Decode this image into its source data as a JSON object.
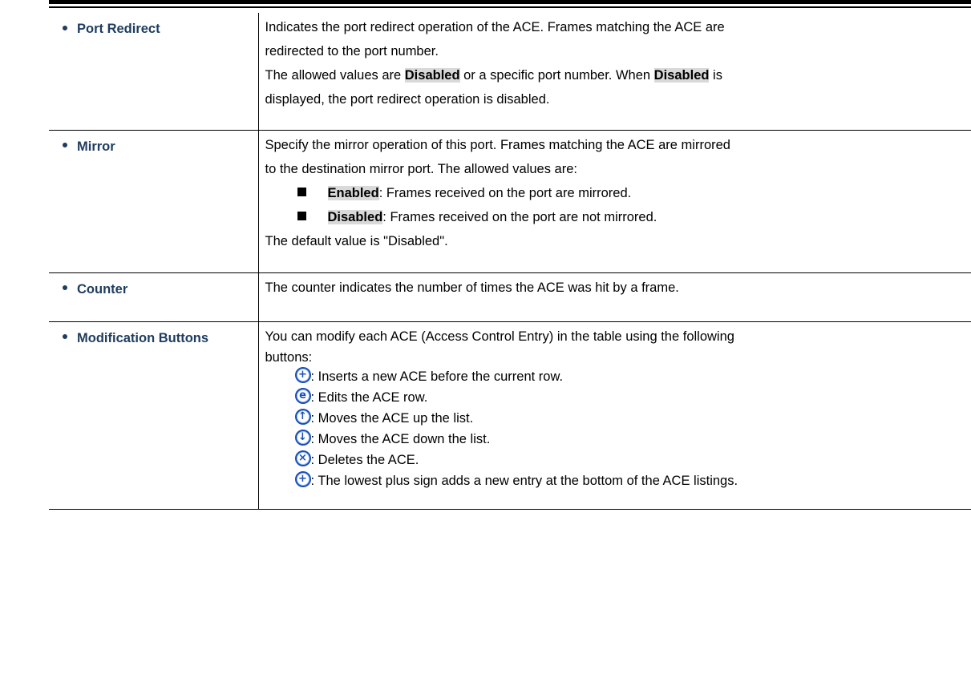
{
  "rows": [
    {
      "name": "Port Redirect",
      "desc1": "Indicates the port redirect operation of the ACE. Frames matching the ACE are",
      "desc2": "redirected to the port number.",
      "desc3a": "The allowed values are ",
      "kw1": "Disabled",
      "desc3b": " or a specific port number. When ",
      "kw2": "Disabled",
      "desc3c": " is",
      "desc4": "displayed, the port redirect operation is disabled."
    },
    {
      "name": "Mirror",
      "desc1": "Specify the mirror operation of this port. Frames matching the ACE are mirrored",
      "desc2": "to the destination mirror port. The allowed values are:",
      "options": [
        {
          "keyword": "Enabled",
          "text": ": Frames received on the port are mirrored."
        },
        {
          "keyword": "Disabled",
          "text": ": Frames received on the port are not mirrored."
        }
      ],
      "default": "The default value is \"Disabled\"."
    },
    {
      "name": "Counter",
      "desc1": "The counter indicates the number of times the ACE was hit by a frame."
    },
    {
      "name": "Modification Buttons",
      "desc1": "You can modify each ACE (Access Control Entry) in the table using the following",
      "desc2": "buttons:",
      "buttons": [
        {
          "icon": "plus-circle-icon",
          "glyph": "+",
          "text": ": Inserts a new ACE before the current row."
        },
        {
          "icon": "edit-circle-icon",
          "glyph": "e",
          "text": ": Edits the ACE row."
        },
        {
          "icon": "up-arrow-circle-icon",
          "glyph": "↑",
          "text": ": Moves the ACE up the list."
        },
        {
          "icon": "down-arrow-circle-icon",
          "glyph": "↓",
          "text": ": Moves the ACE down the list."
        },
        {
          "icon": "delete-circle-icon",
          "glyph": "×",
          "text": ": Deletes the ACE."
        },
        {
          "icon": "plus-circle-icon",
          "glyph": "+",
          "text": ": The lowest plus sign adds a new entry at the bottom of the ACE listings."
        }
      ]
    }
  ],
  "colors": {
    "param_name": "#1f3d60",
    "keyword_bg": "#d9d9d9",
    "icon_blue": "#1a4fb5"
  }
}
